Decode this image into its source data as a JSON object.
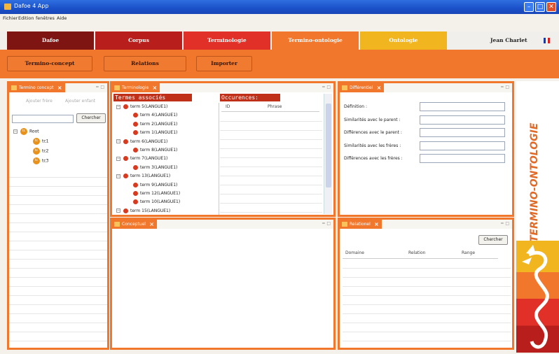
{
  "window": {
    "title": "Dafoe 4 App"
  },
  "menu": [
    "Fichier",
    "Edition",
    "fenêtres",
    "Aide"
  ],
  "modules": [
    {
      "label": "Dafoe",
      "color": "#7e1512"
    },
    {
      "label": "Corpus",
      "color": "#b81f1c"
    },
    {
      "label": "Terminologie",
      "color": "#e03028"
    },
    {
      "label": "Termino-ontologie",
      "color": "#f1772c"
    },
    {
      "label": "Ontologie",
      "color": "#f1b520"
    }
  ],
  "user": "Jean Charlet",
  "toolbar": [
    "Termino-concept",
    "Relations",
    "Importer"
  ],
  "termino_concept": {
    "tab": "Termino concept",
    "add_sibling": "Ajouter frère",
    "add_child": "Ajouter enfant",
    "search_button": "Chercher",
    "root": "Root",
    "children": [
      "tc1",
      "tc2",
      "tc3"
    ],
    "badge": "tc"
  },
  "terminologie": {
    "tab": "Terminologie",
    "assoc_header": "Termes associés",
    "occ_header": "Occurences:",
    "col_id": "ID",
    "col_phrase": "Phrase",
    "terms": [
      {
        "text": "term 5(LANGUE1)",
        "level": 0
      },
      {
        "text": "term 4(LANGUE1)",
        "level": 1
      },
      {
        "text": "term 2(LANGUE1)",
        "level": 1
      },
      {
        "text": "term 1(LANGUE1)",
        "level": 1
      },
      {
        "text": "term 6(LANGUE1)",
        "level": 0
      },
      {
        "text": "term 8(LANGUE1)",
        "level": 1
      },
      {
        "text": "term 7(LANGUE1)",
        "level": 0
      },
      {
        "text": "term 3(LANGUE1)",
        "level": 1
      },
      {
        "text": "term 13(LANGUE1)",
        "level": 0
      },
      {
        "text": "term 9(LANGUE1)",
        "level": 1
      },
      {
        "text": "term 12(LANGUE1)",
        "level": 1
      },
      {
        "text": "term 10(LANGUE1)",
        "level": 1
      },
      {
        "text": "term 15(LANGUE1)",
        "level": 0
      }
    ]
  },
  "differentiel": {
    "tab": "Différentiel",
    "fields": [
      "Définition :",
      "Similarités avec le parent :",
      "Différences avec le parent :",
      "Similarités avec les frères :",
      "Différences avec les frères :"
    ]
  },
  "conceptuel": {
    "tab": "Conceptuel"
  },
  "relationnel": {
    "tab": "Relationel",
    "search_button": "Chercher",
    "columns": [
      "Domaine",
      "Relation",
      "Range"
    ]
  },
  "side_banner": "TERMINO-ONTOLOGIE"
}
